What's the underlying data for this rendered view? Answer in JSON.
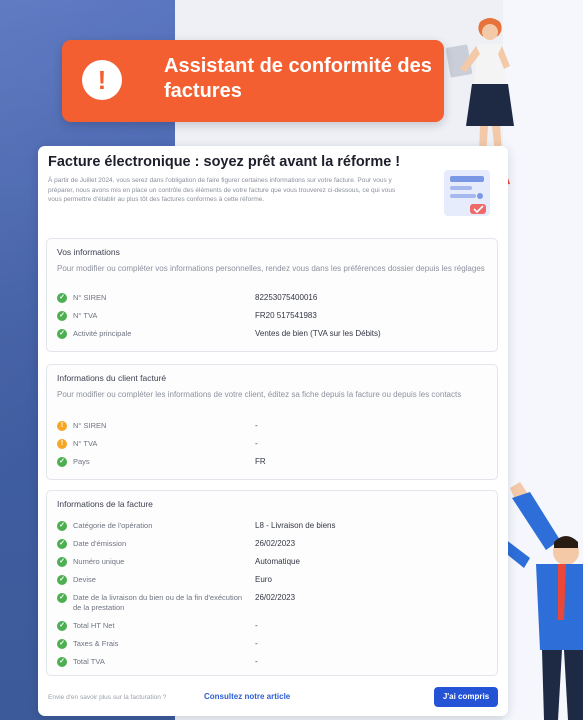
{
  "banner": {
    "icon": "exclamation-icon",
    "title": "Assistant de conformité des factures"
  },
  "card": {
    "title": "Facture électronique : soyez prêt avant la réforme !",
    "intro": "À partir de Juillet 2024, vous serez dans l'obligation de faire figurer certaines informations sur votre facture. Pour vous y préparer, nous avons mis en place un contrôle des éléments de votre facture que vous trouverez ci-dessous, ce qui vous vous permettre d'établir au plus tôt des factures conformes à cette réforme.",
    "sections": {
      "vos_informations": {
        "title": "Vos informations",
        "desc": "Pour modifier ou compléter vos informations personnelles, rendez vous dans les préférences dossier depuis les réglages",
        "rows": [
          {
            "label": "N° SIREN",
            "value": "82253075400016",
            "status": "ok"
          },
          {
            "label": "N° TVA",
            "value": "FR20 517541983",
            "status": "ok"
          },
          {
            "label": "Activité principale",
            "value": "Ventes de bien (TVA sur les Débits)",
            "status": "ok"
          }
        ]
      },
      "client": {
        "title": "Informations du client facturé",
        "desc": "Pour modifier ou compléter les informations de votre client, éditez sa fiche depuis la facture ou depuis les contacts",
        "rows": [
          {
            "label": "N° SIREN",
            "value": "-",
            "status": "warn"
          },
          {
            "label": "N° TVA",
            "value": "-",
            "status": "warn"
          },
          {
            "label": "Pays",
            "value": "FR",
            "status": "ok"
          }
        ]
      },
      "facture": {
        "title": "Informations de la facture",
        "rows": [
          {
            "label": "Catégorie de l'opération",
            "value": "L8 - Livraison de biens",
            "status": "ok"
          },
          {
            "label": "Date d'émission",
            "value": "26/02/2023",
            "status": "ok"
          },
          {
            "label": "Numéro unique",
            "value": "Automatique",
            "status": "ok"
          },
          {
            "label": "Devise",
            "value": "Euro",
            "status": "ok"
          },
          {
            "label": "Date de la livraison du bien ou de la fin d'exécution de la prestation",
            "value": "26/02/2023",
            "status": "ok"
          },
          {
            "label": "Total HT Net",
            "value": "-",
            "status": "ok"
          },
          {
            "label": "Taxes & Frais",
            "value": "-",
            "status": "ok"
          },
          {
            "label": "Total TVA",
            "value": "-",
            "status": "ok"
          }
        ]
      }
    },
    "footer": {
      "text": "Envie d'en savoir plus sur la facturation ?",
      "link": "Consultez notre article",
      "button": "J'ai compris"
    }
  },
  "colors": {
    "banner": "#f45f32",
    "primary": "#2453d6",
    "ok": "#4caf50",
    "warn": "#f5a623"
  }
}
